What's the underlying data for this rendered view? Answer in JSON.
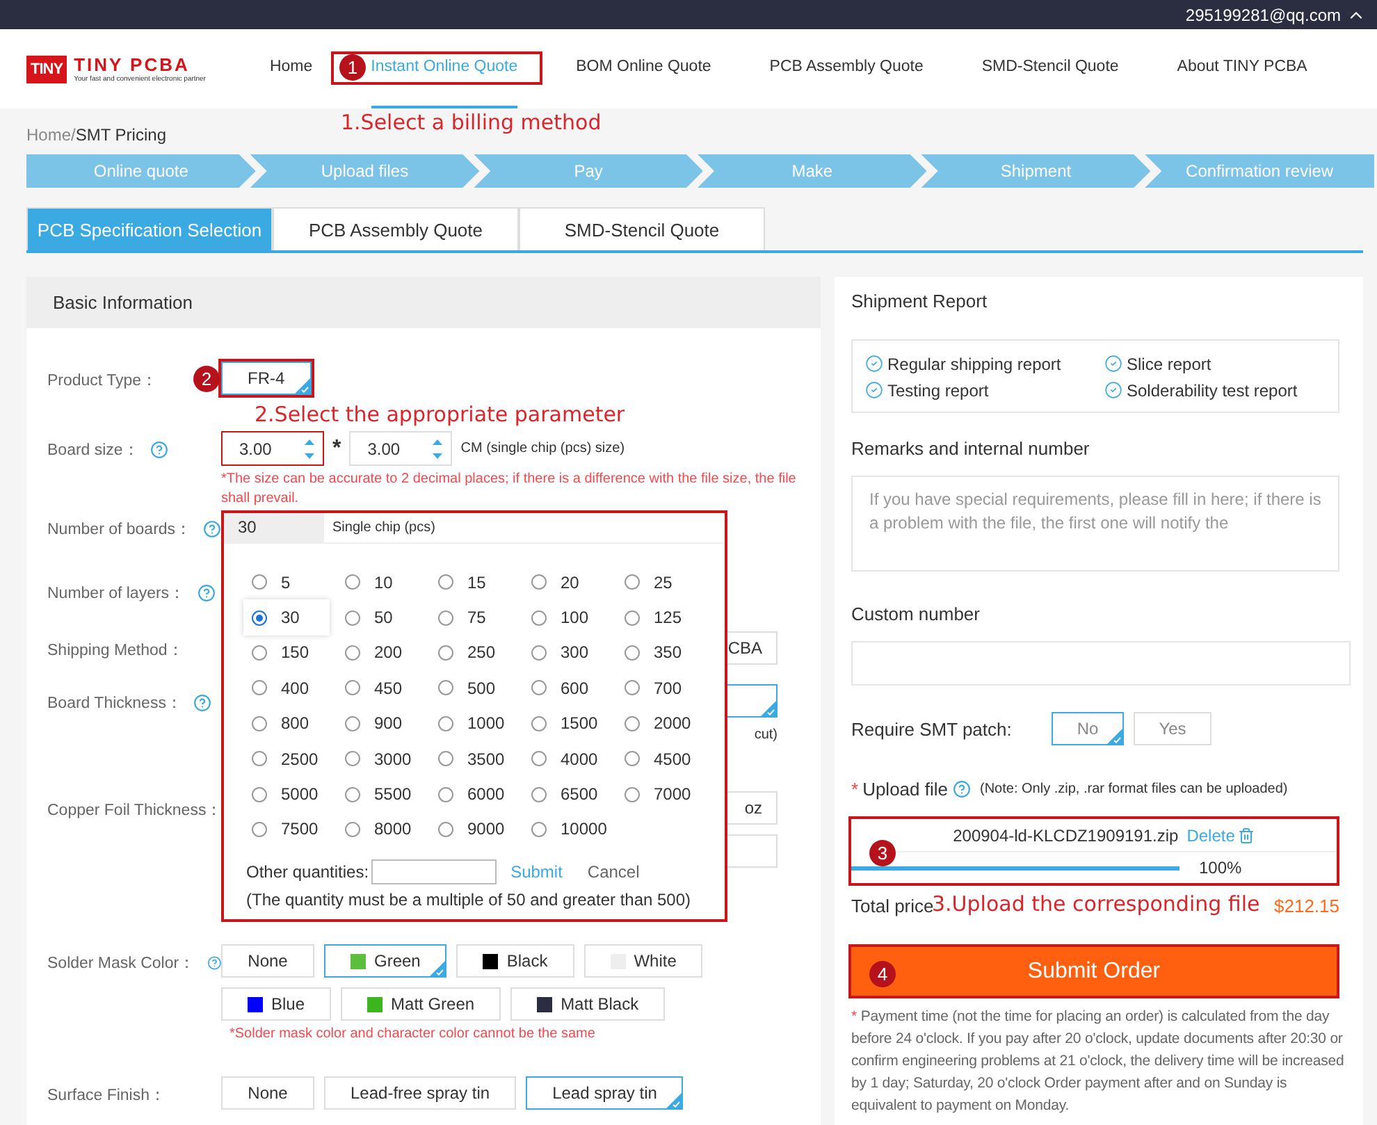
{
  "top_bar": {
    "email": "295199281@qq.com"
  },
  "header": {
    "logo_mark": "TINY",
    "logo_name": "TINY PCBA",
    "logo_tagline": "Your fast and convenient electronic partner",
    "nav": [
      {
        "label": "Home",
        "selected": false
      },
      {
        "label": "Instant Online Quote",
        "selected": true
      },
      {
        "label": "BOM Online Quote",
        "selected": false
      },
      {
        "label": "PCB Assembly Quote",
        "selected": false
      },
      {
        "label": "SMD-Stencil Quote",
        "selected": false
      },
      {
        "label": "About TINY PCBA",
        "selected": false
      }
    ]
  },
  "breadcrumb": {
    "items": [
      "Home",
      "SMT Pricing"
    ],
    "separator": "/"
  },
  "steps": [
    "Online quote",
    "Upload files",
    "Pay",
    "Make",
    "Shipment",
    "Confirmation review"
  ],
  "quote_tabs": [
    {
      "label": "PCB Specification Selection",
      "selected": true
    },
    {
      "label": "PCB Assembly Quote",
      "selected": false
    },
    {
      "label": "SMD-Stencil Quote",
      "selected": false
    }
  ],
  "basic_info": {
    "title": "Basic Information",
    "fields": [
      {
        "kind": "options",
        "label": "Product Type：",
        "help": false,
        "options": [
          {
            "label": "FR-4",
            "selected": true
          }
        ]
      },
      {
        "kind": "size",
        "label": "Board size：",
        "help": true,
        "values": [
          "3.00",
          "3.00"
        ],
        "separator": "*",
        "unit": "CM (single chip (pcs) size)",
        "note": "*The size can be accurate to 2 decimal places; if there is a difference with the file size, the file shall prevail."
      },
      {
        "kind": "quantity",
        "label": "Number of boards：",
        "help": true,
        "popup": {
          "value": "30",
          "unit": "Single chip (pcs)",
          "options": [
            {
              "label": "5",
              "selected": false
            },
            {
              "label": "10",
              "selected": false
            },
            {
              "label": "15",
              "selected": false
            },
            {
              "label": "20",
              "selected": false
            },
            {
              "label": "25",
              "selected": false
            },
            {
              "label": "30",
              "selected": true
            },
            {
              "label": "50",
              "selected": false
            },
            {
              "label": "75",
              "selected": false
            },
            {
              "label": "100",
              "selected": false
            },
            {
              "label": "125",
              "selected": false
            },
            {
              "label": "150",
              "selected": false
            },
            {
              "label": "200",
              "selected": false
            },
            {
              "label": "250",
              "selected": false
            },
            {
              "label": "300",
              "selected": false
            },
            {
              "label": "350",
              "selected": false
            },
            {
              "label": "400",
              "selected": false
            },
            {
              "label": "450",
              "selected": false
            },
            {
              "label": "500",
              "selected": false
            },
            {
              "label": "600",
              "selected": false
            },
            {
              "label": "700",
              "selected": false
            },
            {
              "label": "800",
              "selected": false
            },
            {
              "label": "900",
              "selected": false
            },
            {
              "label": "1000",
              "selected": false
            },
            {
              "label": "1500",
              "selected": false
            },
            {
              "label": "2000",
              "selected": false
            },
            {
              "label": "2500",
              "selected": false
            },
            {
              "label": "3000",
              "selected": false
            },
            {
              "label": "3500",
              "selected": false
            },
            {
              "label": "4000",
              "selected": false
            },
            {
              "label": "4500",
              "selected": false
            },
            {
              "label": "5000",
              "selected": false
            },
            {
              "label": "5500",
              "selected": false
            },
            {
              "label": "6000",
              "selected": false
            },
            {
              "label": "6500",
              "selected": false
            },
            {
              "label": "7000",
              "selected": false
            },
            {
              "label": "7500",
              "selected": false
            },
            {
              "label": "8000",
              "selected": false
            },
            {
              "label": "9000",
              "selected": false
            },
            {
              "label": "10000",
              "selected": false
            }
          ],
          "other_label": "Other quantities:",
          "submit": "Submit",
          "cancel": "Cancel",
          "note": "(The quantity must be a multiple of 50 and greater than 500)"
        }
      },
      {
        "kind": "blank",
        "label": "Number of layers：",
        "help": true
      },
      {
        "kind": "covered",
        "label": "Shipping Method：",
        "help": false,
        "options": [
          {
            "label": "CBA",
            "selected": false
          }
        ]
      },
      {
        "kind": "covered",
        "label": "Board Thickness：",
        "help": true,
        "options": [
          {
            "selected": true
          }
        ],
        "note": "cut)"
      },
      {
        "kind": "covered",
        "label": "Copper Foil Thickness：",
        "help": false,
        "options": [
          {
            "label": "oz",
            "selected": false
          },
          {
            "selected": false
          }
        ]
      },
      {
        "kind": "colors",
        "label": "Solder Mask Color：",
        "help": true,
        "option_rows": [
          [
            {
              "label": "None",
              "selected": false
            },
            {
              "label": "Green",
              "color": "#5dbd3c",
              "selected": true
            },
            {
              "label": "Black",
              "color": "#000000",
              "selected": false
            },
            {
              "label": "White",
              "color": "#eeeeee",
              "selected": false
            }
          ],
          [
            {
              "label": "Blue",
              "color": "#0000ff",
              "selected": false
            },
            {
              "label": "Matt Green",
              "color": "#3db51f",
              "selected": false
            },
            {
              "label": "Matt Black",
              "color": "#2b2d40",
              "selected": false
            }
          ]
        ],
        "note": "*Solder mask color and character color cannot be the same"
      },
      {
        "kind": "options",
        "label": "Surface Finish：",
        "help": false,
        "options": [
          {
            "label": "None",
            "selected": false
          },
          {
            "label": "Lead-free spray tin",
            "selected": false
          },
          {
            "label": "Lead spray tin",
            "selected": true
          }
        ]
      }
    ]
  },
  "shipment_report": {
    "title": "Shipment Report",
    "items": [
      {
        "label": "Regular shipping report",
        "checked": true
      },
      {
        "label": "Slice report",
        "checked": true
      },
      {
        "label": "Testing report",
        "checked": true
      },
      {
        "label": "Solderability test report",
        "checked": true
      }
    ]
  },
  "remarks": {
    "title": "Remarks and internal number",
    "placeholder": "If you have special requirements, please fill in here; if there is a problem with the file, the first one will notify the"
  },
  "custom_number": {
    "title": "Custom number"
  },
  "smt_patch": {
    "label": "Require SMT patch:",
    "options": [
      {
        "label": "No",
        "selected": true
      },
      {
        "label": "Yes",
        "selected": false
      }
    ]
  },
  "upload": {
    "required_mark": "*",
    "label": "Upload file",
    "note": "(Note: Only .zip, .rar format files can be uploaded)",
    "file": {
      "name": "200904-ld-KLCDZ1909191.zip",
      "delete": "Delete",
      "level": 1,
      "reading": "100%"
    }
  },
  "total": {
    "label": "Total price",
    "value": "$212.15"
  },
  "submit": "Submit Order",
  "payment_note": {
    "mark": "*",
    "text": "Payment time (not the time for placing an order) is calculated from the day before 24 o'clock. If you pay after 20 o'clock, update documents after 20:30 or confirm engineering problems at 21 o'clock, the delivery time will be increased by 1 day; Saturday, 20 o'clock Order payment after and on Sunday is equivalent to payment on Monday."
  },
  "annotations": [
    {
      "marker": "1",
      "caption": "1.Select a billing method"
    },
    {
      "marker": "2",
      "caption": "2.Select the appropriate parameter"
    },
    {
      "marker": "3",
      "caption": "3.Upload the corresponding file"
    },
    {
      "marker": "4"
    }
  ]
}
